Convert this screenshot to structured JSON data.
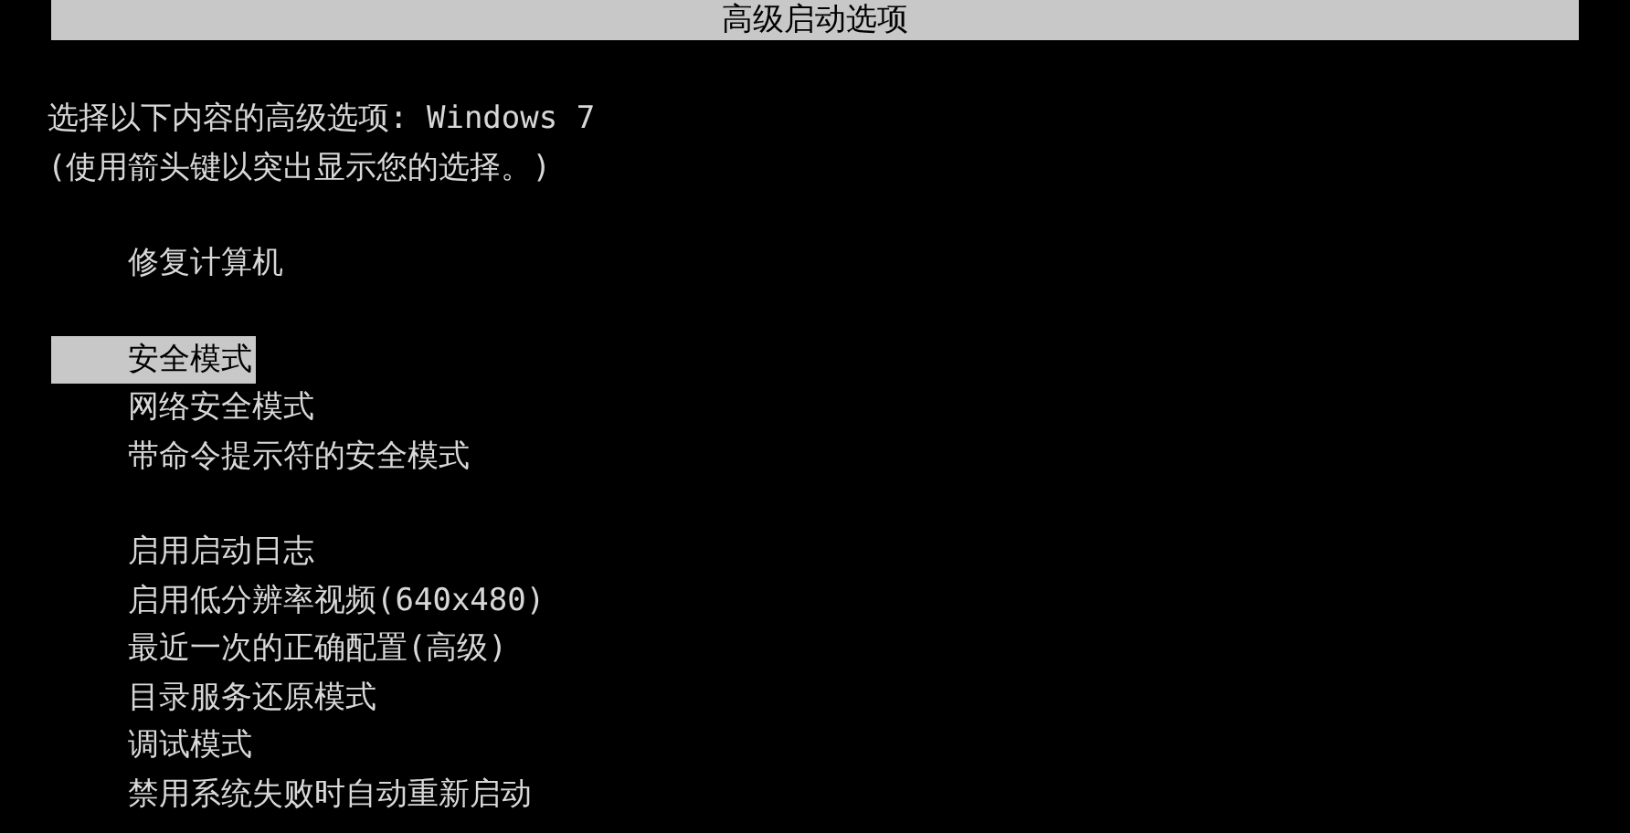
{
  "title": "高级启动选项",
  "instructions": [
    "选择以下内容的高级选项: Windows 7",
    "(使用箭头键以突出显示您的选择。)"
  ],
  "option_groups": [
    {
      "items": [
        {
          "label": "修复计算机",
          "selected": false
        }
      ]
    },
    {
      "items": [
        {
          "label": "安全模式",
          "selected": true
        },
        {
          "label": "网络安全模式",
          "selected": false
        },
        {
          "label": "带命令提示符的安全模式",
          "selected": false
        }
      ]
    },
    {
      "items": [
        {
          "label": "启用启动日志",
          "selected": false
        },
        {
          "label": "启用低分辨率视频(640x480)",
          "selected": false
        },
        {
          "label": "最近一次的正确配置(高级)",
          "selected": false
        },
        {
          "label": "目录服务还原模式",
          "selected": false
        },
        {
          "label": "调试模式",
          "selected": false
        },
        {
          "label": "禁用系统失败时自动重新启动",
          "selected": false
        }
      ]
    }
  ]
}
